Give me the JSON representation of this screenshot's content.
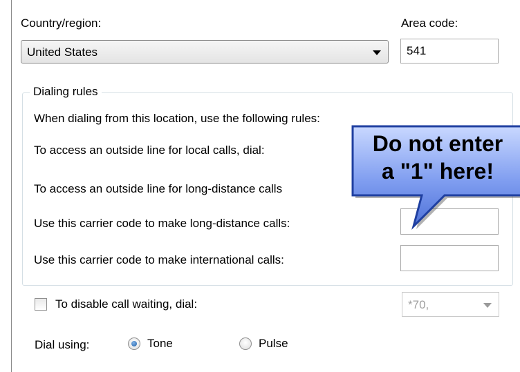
{
  "country": {
    "label": "Country/region:",
    "selected": "United States"
  },
  "area_code": {
    "label": "Area code:",
    "value": "541"
  },
  "dialing_rules": {
    "title": "Dialing rules",
    "intro": "When dialing from this location, use the following rules:",
    "local_label": "To access an outside line for local calls, dial:",
    "long_distance_label": "To access an outside line for long-distance calls",
    "carrier_long_distance_label": "Use this carrier code to make long-distance calls:",
    "carrier_international_label": "Use this carrier code to make international calls:"
  },
  "call_waiting": {
    "label": "To disable call waiting, dial:",
    "checked": false,
    "selected": "*70,"
  },
  "dial_using": {
    "label": "Dial using:",
    "options": [
      "Tone",
      "Pulse"
    ],
    "selected": "Tone"
  },
  "callout": {
    "line1": "Do not enter",
    "line2": "a \"1\" here!",
    "fill_color": "#1f3fa0",
    "text_color": "#000000"
  }
}
